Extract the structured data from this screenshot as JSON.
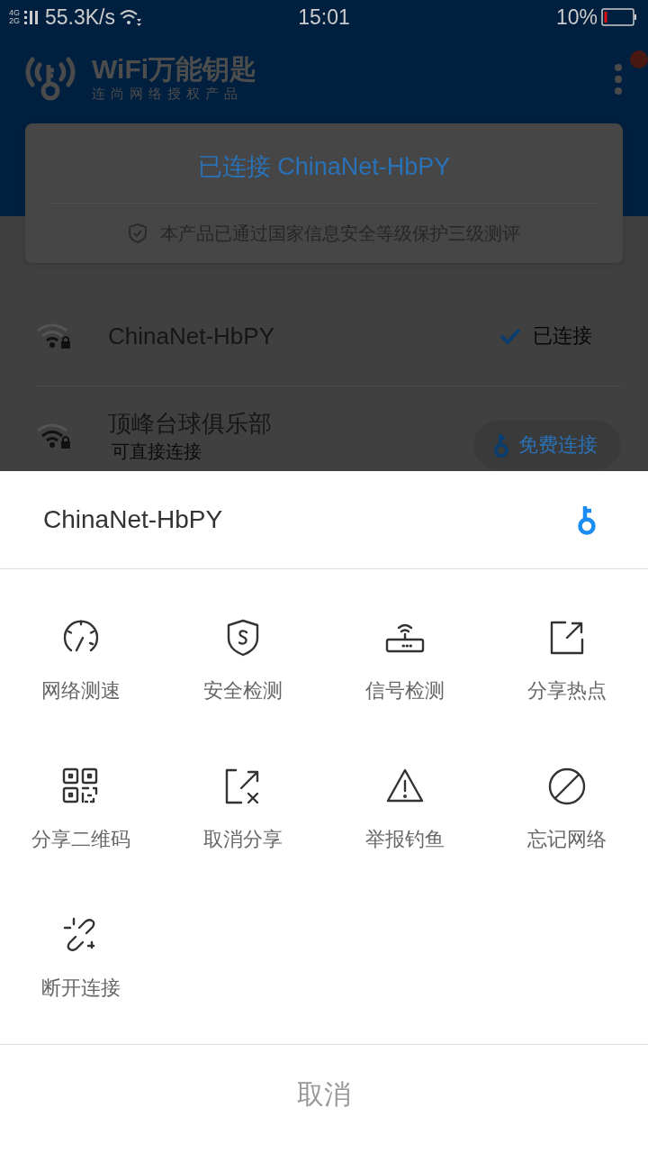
{
  "status_bar": {
    "network_top": "4G",
    "network_bottom": "2G",
    "speed": "55.3K/s",
    "time": "15:01",
    "battery": "10%"
  },
  "header": {
    "title": "WiFi万能钥匙",
    "subtitle": "连尚网络授权产品"
  },
  "card": {
    "title": "已连接 ChinaNet-HbPY",
    "note": "本产品已通过国家信息安全等级保护三级测评"
  },
  "networks": [
    {
      "kind": "connected",
      "name": "ChinaNet-HbPY",
      "status": "已连接"
    },
    {
      "kind": "free",
      "name": "顶峰台球俱乐部",
      "subtitle": "可直接连接",
      "action": "免费连接"
    }
  ],
  "sheet": {
    "title": "ChinaNet-HbPY",
    "actions": [
      {
        "kind": "speed",
        "label": "网络测速"
      },
      {
        "kind": "security",
        "label": "安全检测"
      },
      {
        "kind": "signal",
        "label": "信号检测"
      },
      {
        "kind": "share",
        "label": "分享热点"
      },
      {
        "kind": "qrcode",
        "label": "分享二维码"
      },
      {
        "kind": "unshare",
        "label": "取消分享"
      },
      {
        "kind": "report",
        "label": "举报钓鱼"
      },
      {
        "kind": "forget",
        "label": "忘记网络"
      },
      {
        "kind": "disconnect",
        "label": "断开连接"
      }
    ],
    "cancel": "取消"
  }
}
